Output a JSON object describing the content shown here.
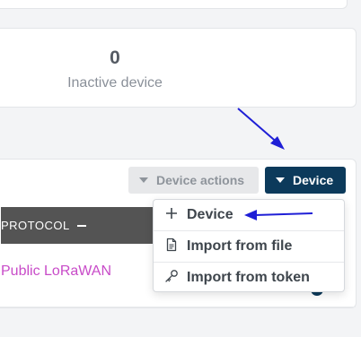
{
  "stats": {
    "inactive_count": "0",
    "inactive_label": "Inactive device"
  },
  "table": {
    "protocol_header": "PROTOCOL",
    "rows": [
      {
        "protocol": "Public LoRaWAN"
      }
    ]
  },
  "toolbar": {
    "device_actions_label": "Device actions",
    "add_device_label": "Device"
  },
  "dropdown": {
    "items": [
      {
        "label": "Device",
        "icon": "plus-icon"
      },
      {
        "label": "Import from file",
        "icon": "file-icon"
      },
      {
        "label": "Import from token",
        "icon": "key-icon"
      }
    ]
  },
  "colors": {
    "primary": "#0c3a5b",
    "protocol_text": "#c84bc8",
    "annotation_arrow": "#1f1fd6",
    "table_header_bg": "#545454"
  }
}
